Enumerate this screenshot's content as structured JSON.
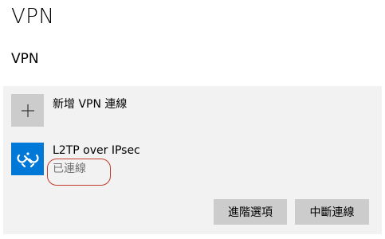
{
  "header": {
    "title": "VPN"
  },
  "section": {
    "title": "VPN"
  },
  "add_connection": {
    "icon": "plus-icon",
    "label": "新增 VPN 連線"
  },
  "connection": {
    "icon": "vpn-link-icon",
    "name": "L2TP over IPsec",
    "status": "已連線",
    "highlight_color": "#c0392b"
  },
  "buttons": {
    "advanced_label": "進階選項",
    "disconnect_label": "中斷連線"
  },
  "colors": {
    "accent": "#0078d7",
    "panel_bg": "#f2f2f2",
    "button_bg": "#cccccc",
    "status_text": "#737373"
  }
}
